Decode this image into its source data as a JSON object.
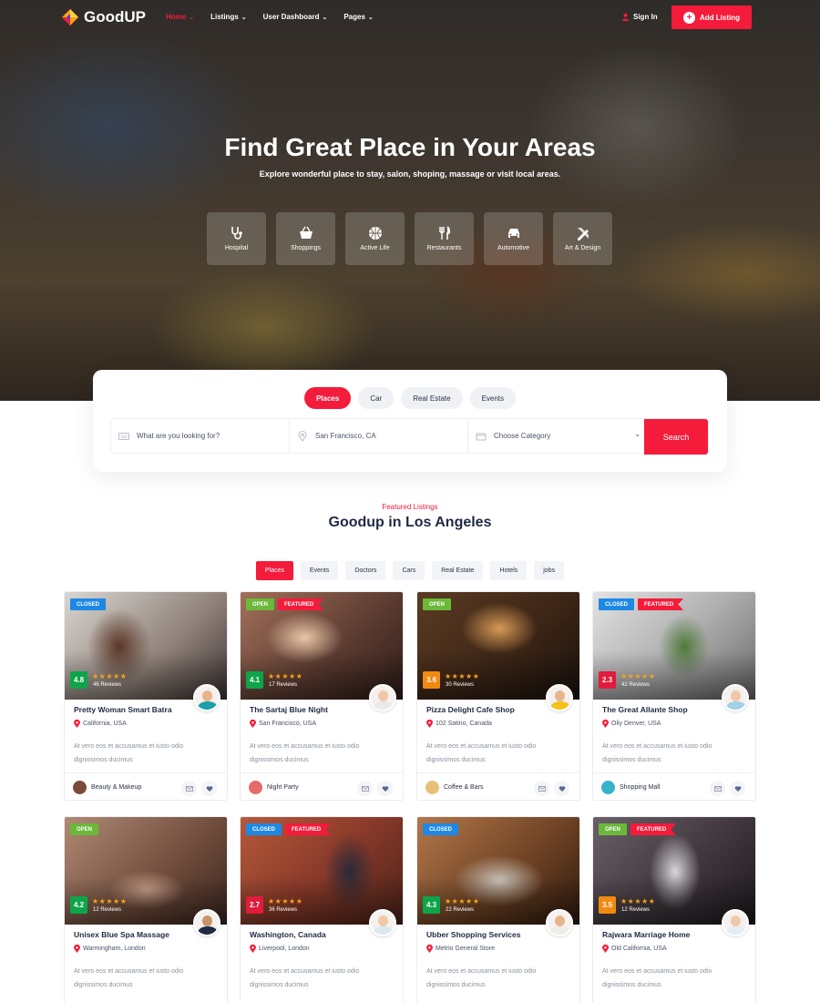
{
  "brand": {
    "name": "GoodUP",
    "accent": "#f41b3b"
  },
  "nav": {
    "items": [
      {
        "label": "Home",
        "active": true
      },
      {
        "label": "Listings",
        "active": false
      },
      {
        "label": "User Dashboard",
        "active": false
      },
      {
        "label": "Pages",
        "active": false
      }
    ],
    "signin": "Sign In",
    "add_listing": "Add Listing"
  },
  "hero": {
    "title": "Find Great Place in Your Areas",
    "subtitle": "Explore wonderful place to stay, salon, shoping, massage or visit local areas.",
    "categories": [
      {
        "label": "Hospital",
        "icon": "stethoscope-icon"
      },
      {
        "label": "Shoppings",
        "icon": "basket-icon"
      },
      {
        "label": "Active Life",
        "icon": "basketball-icon"
      },
      {
        "label": "Restaurants",
        "icon": "utensils-icon"
      },
      {
        "label": "Automotive",
        "icon": "car-icon"
      },
      {
        "label": "Art & Design",
        "icon": "pencil-ruler-icon"
      }
    ]
  },
  "search": {
    "tabs": [
      {
        "label": "Places",
        "active": true
      },
      {
        "label": "Car",
        "active": false
      },
      {
        "label": "Real Estate",
        "active": false
      },
      {
        "label": "Events",
        "active": false
      }
    ],
    "keyword_placeholder": "What are you looking for?",
    "location_value": "San Francisco, CA",
    "category_value": "Choose Category",
    "button": "Search"
  },
  "section": {
    "subtitle": "Featured Listings",
    "title": "Goodup in Los Angeles",
    "filters": [
      {
        "label": "Places",
        "active": true
      },
      {
        "label": "Events",
        "active": false
      },
      {
        "label": "Doctors",
        "active": false
      },
      {
        "label": "Cars",
        "active": false
      },
      {
        "label": "Real Estate",
        "active": false
      },
      {
        "label": "Hotels",
        "active": false
      },
      {
        "label": "jobs",
        "active": false
      }
    ]
  },
  "listings": [
    {
      "status": "Closed",
      "featured": false,
      "rating": "4.8",
      "rating_color": "green",
      "reviews": "46 Reviews",
      "title": "Pretty Woman Smart Batra",
      "location": "California, USA",
      "desc": "At vero eos et accusamus et iusto odio dignissimos ducimus",
      "category": "Beauty & Makeup",
      "cat_color": "#7a4a3a"
    },
    {
      "status": "Open",
      "featured": true,
      "rating": "4.1",
      "rating_color": "green",
      "reviews": "17 Reviews",
      "title": "The Sartaj Blue Night",
      "location": "San Francisco, USA",
      "desc": "At vero eos et accusamus et iusto odio dignissimos ducimus",
      "category": "Night Party",
      "cat_color": "#e76a6a"
    },
    {
      "status": "Open",
      "featured": false,
      "rating": "3.6",
      "rating_color": "orange",
      "reviews": "30 Reviews",
      "title": "Pizza Delight Cafe Shop",
      "location": "102 Satirio, Canada",
      "desc": "At vero eos et accusamus et iusto odio dignissimos ducimus",
      "category": "Coffee & Bars",
      "cat_color": "#e6c07a"
    },
    {
      "status": "Closed",
      "featured": true,
      "rating": "2.3",
      "rating_color": "red",
      "reviews": "42 Reviews",
      "title": "The Great Allante Shop",
      "location": "Oliy Denver, USA",
      "desc": "At vero eos et accusamus et iusto odio dignissimos ducimus",
      "category": "Shopping Mall",
      "cat_color": "#36b2c9"
    },
    {
      "status": "Open",
      "featured": false,
      "rating": "4.2",
      "rating_color": "green",
      "reviews": "12 Reviews",
      "title": "Unisex Blue Spa Massage",
      "location": "Warmingham, London",
      "desc": "At vero eos et accusamus et iusto odio dignissimos ducimus",
      "category": "",
      "cat_color": "#7a4a3a"
    },
    {
      "status": "Closed",
      "featured": true,
      "rating": "2.7",
      "rating_color": "red",
      "reviews": "36 Reviews",
      "title": "Washington, Canada",
      "location": "Liverpool, London",
      "desc": "At vero eos et accusamus et iusto odio dignissimos ducimus",
      "category": "",
      "cat_color": "#e76a6a"
    },
    {
      "status": "Closed",
      "featured": false,
      "rating": "4.3",
      "rating_color": "green",
      "reviews": "22 Reviews",
      "title": "Ubber Shopping Services",
      "location": "Metrio General Store",
      "desc": "At vero eos et accusamus et iusto odio dignissimos ducimus",
      "category": "",
      "cat_color": "#e6c07a"
    },
    {
      "status": "Open",
      "featured": true,
      "rating": "3.5",
      "rating_color": "orange",
      "reviews": "12 Reviews",
      "title": "Rajwara Marriage Home",
      "location": "Old California, USA",
      "desc": "At vero eos et accusamus et iusto odio dignissimos ducimus",
      "category": "",
      "cat_color": "#36b2c9"
    }
  ]
}
